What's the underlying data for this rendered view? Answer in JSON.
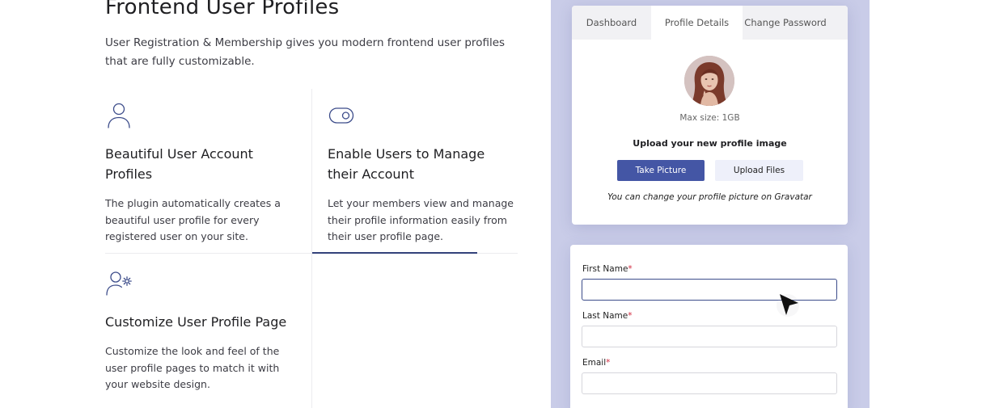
{
  "page": {
    "title": "Frontend User Profiles",
    "subtitle": "User Registration & Membership gives you modern frontend user profiles that are fully customizable."
  },
  "features": [
    {
      "icon": "user-icon",
      "title": "Beautiful User Account Profiles",
      "description": "The plugin automatically creates a beautiful user profile for every registered user on your site."
    },
    {
      "icon": "toggle-icon",
      "title": "Enable Users to Manage their Account",
      "description": "Let your members view and manage their profile information easily from their user profile page."
    },
    {
      "icon": "user-settings-icon",
      "title": "Customize User Profile Page",
      "description": "Customize the look and feel of the user profile pages to match it with your website design."
    }
  ],
  "profile_card": {
    "tabs": [
      "Dashboard",
      "Profile Details",
      "Change Password"
    ],
    "active_tab": "Profile Details",
    "max_size": "Max size: 1GB",
    "upload_title": "Upload your new profile image",
    "take_picture": "Take Picture",
    "upload_files": "Upload Files",
    "gravatar_note": "You can change your profile picture on Gravatar"
  },
  "form": {
    "first_name_label": "First Name",
    "last_name_label": "Last Name",
    "email_label": "Email",
    "required_mark": "*",
    "first_name_value": "",
    "last_name_value": "",
    "email_value": ""
  },
  "colors": {
    "accent": "#4456a5",
    "panel_background": "#c9cce8",
    "required": "#d22a3f",
    "active_border": "#3c4c8a",
    "icon_stroke": "#3c4c8a"
  }
}
